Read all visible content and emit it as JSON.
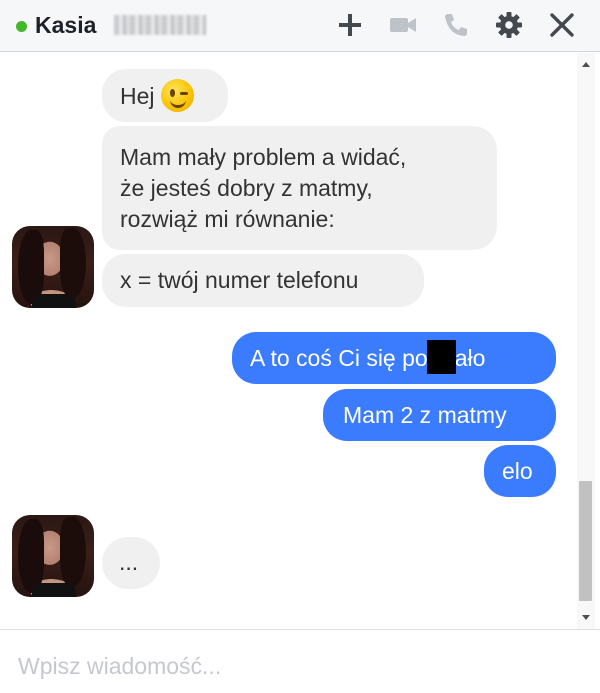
{
  "header": {
    "contact_name": "Kasia",
    "online": true,
    "actions": [
      {
        "name": "add-people-button",
        "icon": "plus-icon"
      },
      {
        "name": "video-call-button",
        "icon": "video-camera-icon"
      },
      {
        "name": "voice-call-button",
        "icon": "phone-icon"
      },
      {
        "name": "options-button",
        "icon": "gear-icon"
      },
      {
        "name": "close-button",
        "icon": "close-icon"
      }
    ]
  },
  "messages": {
    "incoming": [
      {
        "text": "Hej",
        "emoji": "winking-face-icon"
      },
      {
        "text": "Mam mały problem a widać,\nże jesteś dobry z matmy,\nrozwiąż mi równanie:"
      },
      {
        "text": "x = twój numer telefonu"
      }
    ],
    "outgoing": [
      {
        "text_before": "A to coś Ci się po",
        "text_after": "ało",
        "redacted": true
      },
      {
        "text": "Mam 2 z matmy"
      },
      {
        "text": "elo"
      }
    ],
    "typing": {
      "text": "..."
    }
  },
  "composer": {
    "placeholder": "Wpisz wiadomość..."
  },
  "colors": {
    "accent": "#3b7cff",
    "incoming_bubble": "#f1f0f0",
    "online": "#42b72a",
    "icon_active": "#444950",
    "icon_disabled": "#bec2c9"
  }
}
